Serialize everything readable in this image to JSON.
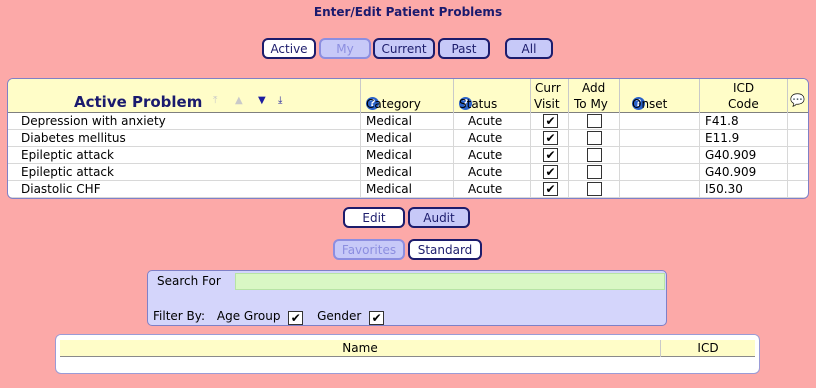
{
  "title": "Enter/Edit Patient Problems",
  "filters": {
    "active": "Active",
    "my": "My",
    "current": "Current",
    "past": "Past",
    "all": "All"
  },
  "grid": {
    "headers": {
      "problem": "Active Problem",
      "category": "Category",
      "status": "Status",
      "curr_visit_1": "Curr",
      "curr_visit_2": "Visit",
      "add_to_my_1": "Add",
      "add_to_my_2": "To My",
      "onset": "Onset",
      "icd_1": "ICD",
      "icd_2": "Code"
    },
    "rows": [
      {
        "problem": "Depression with anxiety",
        "category": "Medical",
        "status": "Acute",
        "curr_visit": true,
        "add_to_my": false,
        "onset": "",
        "icd": "F41.8"
      },
      {
        "problem": "Diabetes mellitus",
        "category": "Medical",
        "status": "Acute",
        "curr_visit": true,
        "add_to_my": false,
        "onset": "",
        "icd": "E11.9"
      },
      {
        "problem": "Epileptic attack",
        "category": "Medical",
        "status": "Acute",
        "curr_visit": true,
        "add_to_my": false,
        "onset": "",
        "icd": "G40.909"
      },
      {
        "problem": "Epileptic attack",
        "category": "Medical",
        "status": "Acute",
        "curr_visit": true,
        "add_to_my": false,
        "onset": "",
        "icd": "G40.909"
      },
      {
        "problem": "Diastolic CHF",
        "category": "Medical",
        "status": "Acute",
        "curr_visit": true,
        "add_to_my": false,
        "onset": "",
        "icd": "I50.30"
      }
    ]
  },
  "actions": {
    "edit": "Edit",
    "audit": "Audit",
    "favorites": "Favorites",
    "standard": "Standard"
  },
  "search": {
    "label": "Search For",
    "value": "",
    "filter_by": "Filter By:",
    "age_group": "Age Group",
    "age_group_checked": true,
    "gender": "Gender",
    "gender_checked": true
  },
  "results": {
    "name_header": "Name",
    "icd_header": "ICD"
  },
  "colors": {
    "background": "#fca9a8",
    "header_yellow": "#fffdc8",
    "button_blue": "#c7c9f8",
    "search_green": "#d9f7c4"
  }
}
